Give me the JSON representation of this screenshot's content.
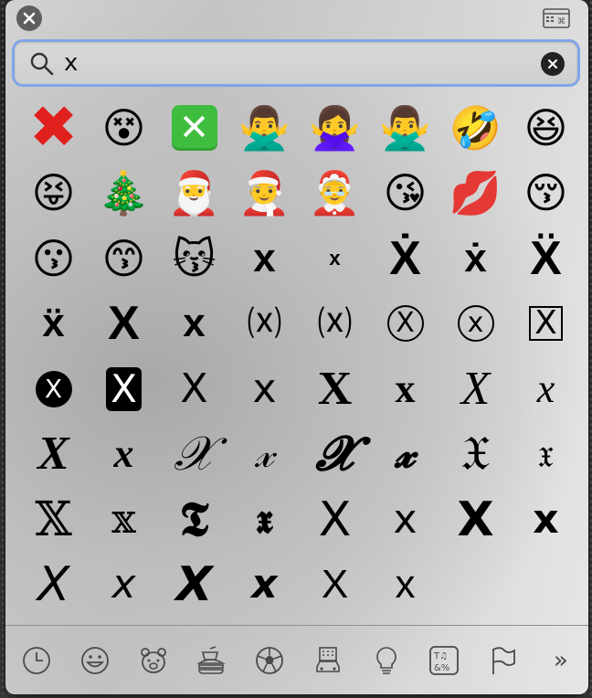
{
  "search": {
    "value": "x"
  },
  "emoji_grid": [
    {
      "char": "✖",
      "style": "redx"
    },
    {
      "char": "😵",
      "style": "emoji"
    },
    {
      "char": "✕",
      "style": "greenbox"
    },
    {
      "char": "🙅‍♂️",
      "style": "emoji"
    },
    {
      "char": "🙅‍♀️",
      "style": "emoji"
    },
    {
      "char": "🙅‍♂️",
      "style": "emoji"
    },
    {
      "char": "🤣",
      "style": "emoji"
    },
    {
      "char": "😆",
      "style": "emoji"
    },
    {
      "char": "😝",
      "style": "emoji"
    },
    {
      "char": "🎄",
      "style": "emoji"
    },
    {
      "char": "🎅",
      "style": "emoji"
    },
    {
      "char": "🧑‍🎄",
      "style": "emoji"
    },
    {
      "char": "🤶",
      "style": "emoji"
    },
    {
      "char": "😘",
      "style": "emoji"
    },
    {
      "char": "💋",
      "style": "emoji"
    },
    {
      "char": "😚",
      "style": "emoji"
    },
    {
      "char": "😗",
      "style": "emoji"
    },
    {
      "char": "😙",
      "style": "emoji"
    },
    {
      "char": "😽",
      "style": "emoji"
    },
    {
      "char": "x",
      "style": "f-lib bold mid"
    },
    {
      "char": "x",
      "style": "f-lib bold tiny"
    },
    {
      "char": "Ẋ",
      "style": "f-lib bold big"
    },
    {
      "char": "ẋ",
      "style": "f-lib bold mid"
    },
    {
      "char": "Ẍ",
      "style": "f-lib bold big"
    },
    {
      "char": "ẍ",
      "style": "f-lib bold mid"
    },
    {
      "char": "X",
      "style": "f-lib bold big"
    },
    {
      "char": "x",
      "style": "f-lib bold mid"
    },
    {
      "char": "⒳",
      "style": "f-sans small"
    },
    {
      "char": "⒳",
      "style": "f-sans small"
    },
    {
      "char": "X",
      "style": "circled f-sans"
    },
    {
      "char": "x",
      "style": "circled f-sans"
    },
    {
      "char": "X",
      "style": "boxed f-sans"
    },
    {
      "char": "X",
      "style": "blackcircle f-sans"
    },
    {
      "char": "X",
      "style": "blackbox f-sans"
    },
    {
      "char": "X",
      "style": "f-sans mid"
    },
    {
      "char": "x",
      "style": "f-sans mid"
    },
    {
      "char": "X",
      "style": "f-libserif bold big"
    },
    {
      "char": "x",
      "style": "f-libserif bold mid"
    },
    {
      "char": "X",
      "style": "f-libserif italic big"
    },
    {
      "char": "x",
      "style": "f-libserif italic mid"
    },
    {
      "char": "X",
      "style": "f-libserif bold italic big"
    },
    {
      "char": "x",
      "style": "f-libserif bold italic mid"
    },
    {
      "char": "𝒳",
      "style": "f-serif italic big"
    },
    {
      "char": "𝓍",
      "style": "f-serif italic mid"
    },
    {
      "char": "𝓧",
      "style": "f-serif bold italic big"
    },
    {
      "char": "𝔁",
      "style": "f-serif bold italic mid"
    },
    {
      "char": "𝔛",
      "style": "f-serif big"
    },
    {
      "char": "𝔵",
      "style": "f-serif mid"
    },
    {
      "char": "𝕏",
      "style": "f-serif big"
    },
    {
      "char": "𝕩",
      "style": "f-serif mid"
    },
    {
      "char": "𝕿",
      "style": "f-serif bold big"
    },
    {
      "char": "𝖝",
      "style": "f-serif bold mid"
    },
    {
      "char": "X",
      "style": "f-sans big"
    },
    {
      "char": "x",
      "style": "f-sans mid"
    },
    {
      "char": "X",
      "style": "f-sans bold big"
    },
    {
      "char": "x",
      "style": "f-sans bold mid"
    },
    {
      "char": "X",
      "style": "f-sans italic big"
    },
    {
      "char": "x",
      "style": "f-sans italic mid"
    },
    {
      "char": "X",
      "style": "f-sans bold italic big"
    },
    {
      "char": "x",
      "style": "f-sans bold italic mid"
    },
    {
      "char": "X",
      "style": "f-lib mid"
    },
    {
      "char": "x",
      "style": "f-lib mid"
    }
  ],
  "toolbar": {
    "categories": [
      "recent",
      "smileys",
      "animals",
      "food",
      "activity",
      "travel",
      "objects",
      "symbols",
      "flags"
    ],
    "more_label": "»"
  }
}
